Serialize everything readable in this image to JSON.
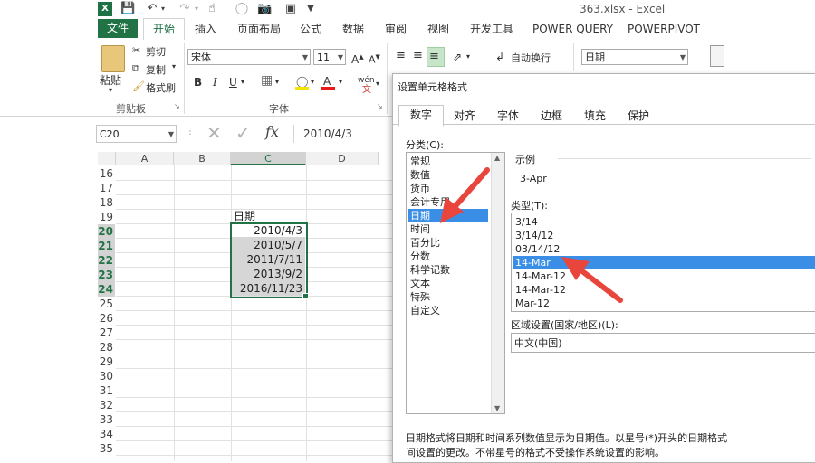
{
  "app": {
    "window_title": "363.xlsx - Excel",
    "logo_text": "X"
  },
  "qat": {
    "save_icon": "save-icon",
    "undo_icon": "undo-icon",
    "redo_icon": "redo-icon"
  },
  "tabs": [
    {
      "label": "文件"
    },
    {
      "label": "开始"
    },
    {
      "label": "插入"
    },
    {
      "label": "页面布局"
    },
    {
      "label": "公式"
    },
    {
      "label": "数据"
    },
    {
      "label": "审阅"
    },
    {
      "label": "视图"
    },
    {
      "label": "开发工具"
    },
    {
      "label": "POWER QUERY"
    },
    {
      "label": "POWERPIVOT"
    }
  ],
  "ribbon": {
    "paste_label": "粘贴",
    "cut_label": "剪切",
    "copy_label": "复制",
    "format_painter_label": "格式刷",
    "clipboard_group": "剪贴板",
    "font_name": "宋体",
    "font_size": "11",
    "bold": "B",
    "italic": "I",
    "underline": "U",
    "font_color_glyph": "A",
    "phonetic_glyph": "wén",
    "font_group": "字体",
    "wrap_text_label": "自动换行",
    "number_format": "日期"
  },
  "formula_bar": {
    "name_box": "C20",
    "fx": "fx",
    "content": "2010/4/3"
  },
  "sheet": {
    "columns": [
      "A",
      "B",
      "C",
      "D"
    ],
    "rows": [
      "16",
      "17",
      "18",
      "19",
      "20",
      "21",
      "22",
      "23",
      "24",
      "25",
      "26",
      "27",
      "28",
      "29",
      "30",
      "31",
      "32",
      "33",
      "34",
      "35"
    ],
    "header_cell": "日期",
    "dates": [
      "2010/4/3",
      "2010/5/7",
      "2011/7/11",
      "2013/9/2",
      "2016/11/23"
    ]
  },
  "dialog": {
    "title": "设置单元格格式",
    "tabs": [
      "数字",
      "对齐",
      "字体",
      "边框",
      "填充",
      "保护"
    ],
    "category_label": "分类(C):",
    "categories": [
      "常规",
      "数值",
      "货币",
      "会计专用",
      "日期",
      "时间",
      "百分比",
      "分数",
      "科学记数",
      "文本",
      "特殊",
      "自定义"
    ],
    "selected_category": "日期",
    "sample_label": "示例",
    "sample_value": "3-Apr",
    "type_label": "类型(T):",
    "types": [
      "3/14",
      "3/14/12",
      "03/14/12",
      "14-Mar",
      "14-Mar-12",
      "14-Mar-12",
      "Mar-12"
    ],
    "selected_type": "14-Mar",
    "locale_label": "区域设置(国家/地区)(L):",
    "locale_value": "中文(中国)",
    "description_line1": "日期格式将日期和时间系列数值显示为日期值。以星号(*)开头的日期格式",
    "description_line2": "间设置的更改。不带星号的格式不受操作系统设置的影响。"
  },
  "colors": {
    "excel_green": "#217346",
    "selection_blue": "#3b8ee5",
    "arrow_red": "#e8463c"
  }
}
